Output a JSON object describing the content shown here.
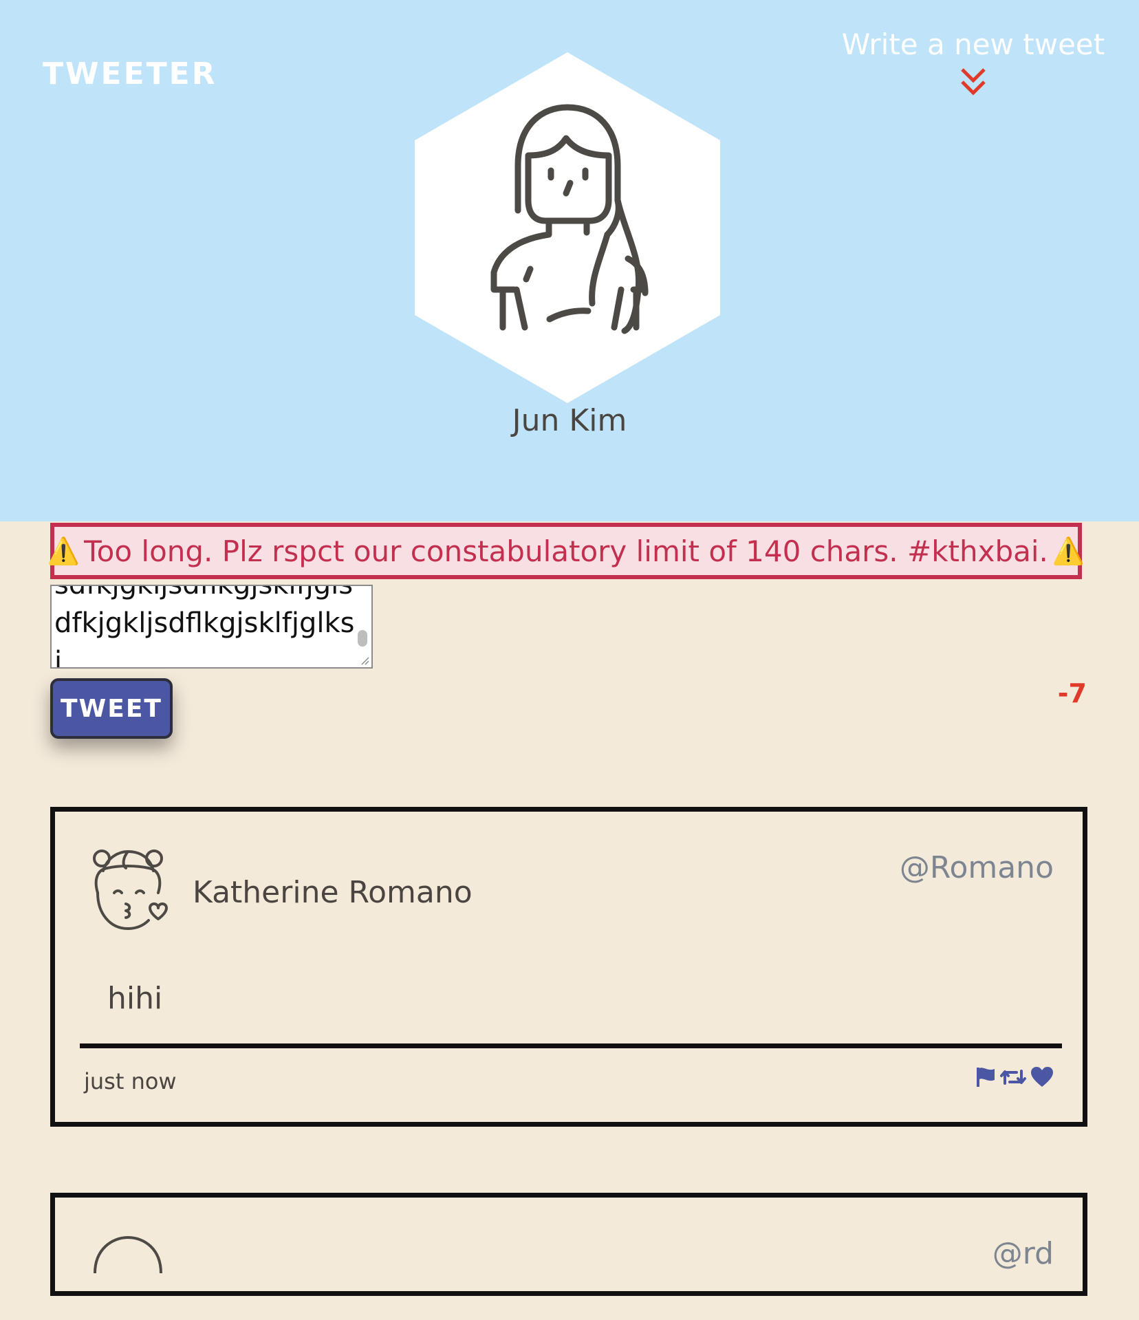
{
  "header": {
    "brand": "TWEETER",
    "compose_label": "Write a new tweet",
    "profile_name": "Jun Kim"
  },
  "composer": {
    "error_message": "Too long. Plz rspct our constabulatory limit of 140 chars. #kthxbai.",
    "text_value": "sdfkjgkljsdflkgjsklfjglsdfkjgkljsdflkgjsklfjglksj",
    "counter": "-7",
    "button_label": "TWEET"
  },
  "tweets": [
    {
      "name": "Katherine Romano",
      "handle": "@Romano",
      "body": "hihi",
      "time": "just now"
    },
    {
      "handle": "@rd"
    }
  ],
  "colors": {
    "header_bg": "#bfe3f8",
    "page_bg": "#f4eada",
    "error_red": "#c3304f",
    "button_blue": "#4b57a2",
    "counter_red": "#e03a2a"
  }
}
